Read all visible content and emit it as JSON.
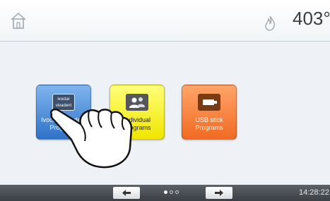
{
  "header": {
    "temperature": "403°"
  },
  "tiles": [
    {
      "label": "Ivoclar Vivadent Programs",
      "logo_text": "ivoclar vivadent"
    },
    {
      "label": "Individual Programs"
    },
    {
      "label": "USB stick Programs"
    }
  ],
  "icons": {
    "home": "home-icon",
    "flame": "flame-icon",
    "hand": "pointing-hand-icon"
  },
  "footer": {
    "time": "14:28:22",
    "page_indicator": {
      "total": 3,
      "current": 1
    }
  },
  "colors": {
    "blue_tile": "#2f72c8",
    "yellow_tile": "#f0e600",
    "orange_tile": "#f06a22"
  }
}
